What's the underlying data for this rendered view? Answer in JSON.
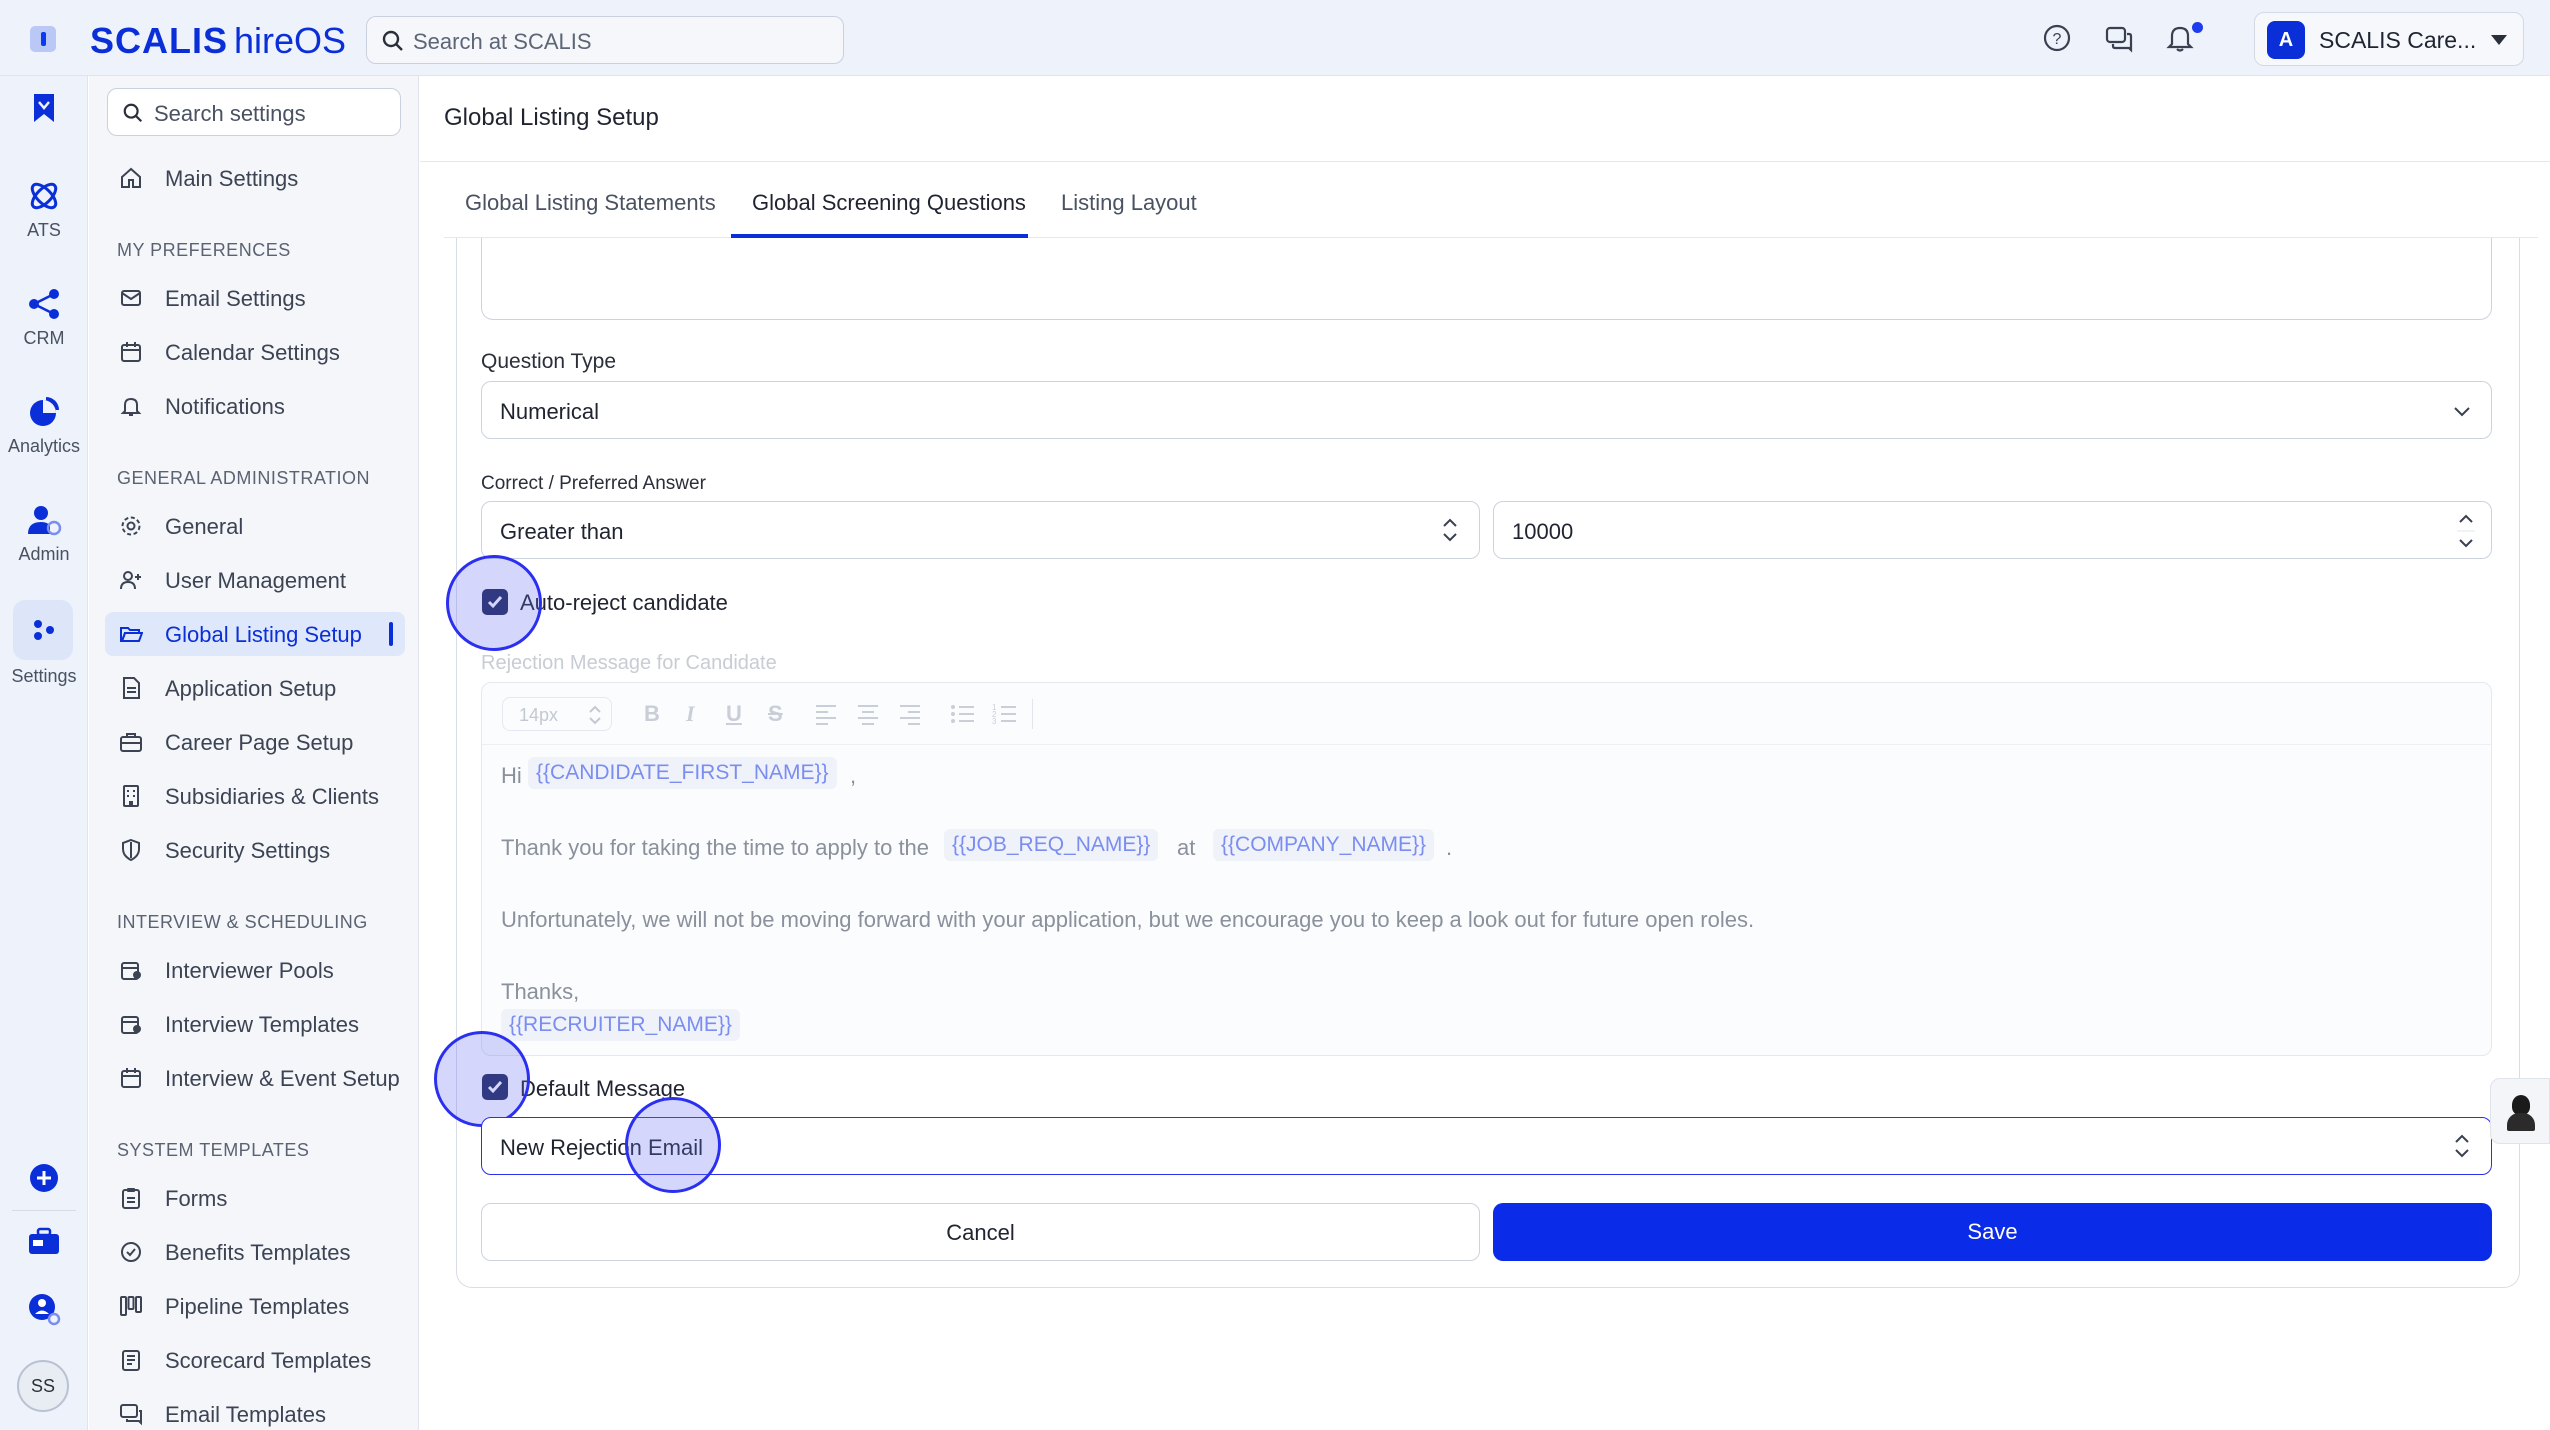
{
  "app": {
    "brand_main": "SCALIS",
    "brand_sub": "hireOS",
    "search_placeholder": "Search at SCALIS",
    "account_name": "SCALIS Care...",
    "account_initial": "A"
  },
  "rail": {
    "items": [
      {
        "label": ""
      },
      {
        "label": "ATS"
      },
      {
        "label": "CRM"
      },
      {
        "label": "Analytics"
      },
      {
        "label": "Admin"
      },
      {
        "label": "Settings"
      }
    ],
    "user_initials": "SS"
  },
  "sidebar": {
    "search_placeholder": "Search settings",
    "main_settings": "Main Settings",
    "sections": [
      {
        "heading": "MY PREFERENCES",
        "items": [
          "Email Settings",
          "Calendar Settings",
          "Notifications"
        ]
      },
      {
        "heading": "GENERAL ADMINISTRATION",
        "items": [
          "General",
          "User Management",
          "Global Listing Setup",
          "Application Setup",
          "Career Page Setup",
          "Subsidiaries & Clients",
          "Security Settings"
        ]
      },
      {
        "heading": "INTERVIEW & SCHEDULING",
        "items": [
          "Interviewer Pools",
          "Interview Templates",
          "Interview & Event Setup"
        ]
      },
      {
        "heading": "SYSTEM TEMPLATES",
        "items": [
          "Forms",
          "Benefits Templates",
          "Pipeline Templates",
          "Scorecard Templates",
          "Email Templates"
        ]
      }
    ],
    "active_item": "Global Listing Setup"
  },
  "main": {
    "title": "Global Listing Setup",
    "tabs": [
      "Global Listing Statements",
      "Global Screening Questions",
      "Listing Layout"
    ],
    "active_tab": "Global Screening Questions",
    "question_type_label": "Question Type",
    "question_type_value": "Numerical",
    "answer_label": "Correct / Preferred Answer",
    "answer_operator": "Greater than",
    "answer_value": "10000",
    "auto_reject_label": "Auto-reject candidate",
    "auto_reject_checked": true,
    "rejection_label": "Rejection Message for Candidate",
    "editor": {
      "font_size": "14px",
      "greeting": "Hi",
      "token_first_name": "{{CANDIDATE_FIRST_NAME}}",
      "comma": ",",
      "line2_prefix": "Thank you for taking the time to apply to the",
      "token_job": "{{JOB_REQ_NAME}}",
      "line2_at": "at",
      "token_company": "{{COMPANY_NAME}}",
      "line2_end": ".",
      "line3": "Unfortunately, we will not be moving forward with your application, but we encourage you to keep a look out for future open roles.",
      "sign_off": "Thanks,",
      "token_recruiter": "{{RECRUITER_NAME}}"
    },
    "default_message_label": "Default Message",
    "default_message_checked": true,
    "template_value": "New Rejection Email",
    "cancel_label": "Cancel",
    "save_label": "Save"
  },
  "colors": {
    "brand": "#0a2fd9",
    "save_button": "#0a2be8",
    "checkbox": "#1f2559",
    "token_text": "#7a8df0",
    "click_halo": "#2b2ff0"
  }
}
